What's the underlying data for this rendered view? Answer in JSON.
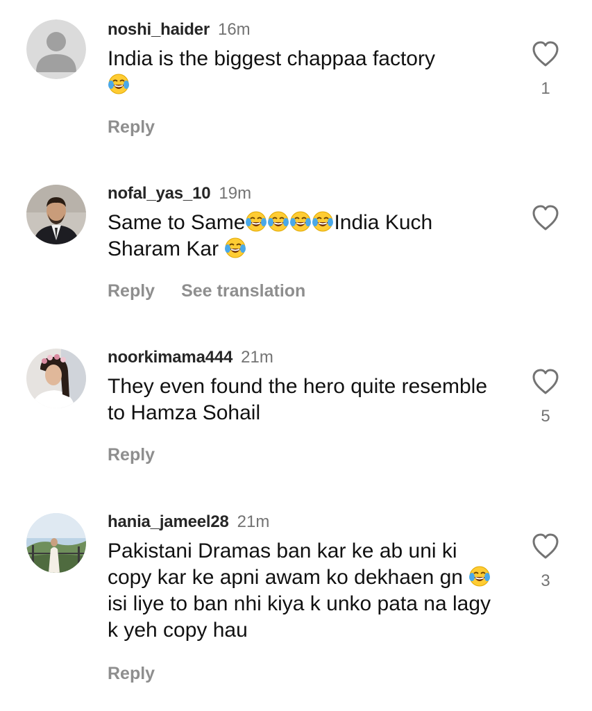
{
  "comments": [
    {
      "username": "noshi_haider",
      "time": "16m",
      "text_parts": [
        "India is the biggest chappaa factory",
        ""
      ],
      "likes": "1",
      "reply_label": "Reply",
      "avatar": "default-avatar"
    },
    {
      "username": "nofal_yas_10",
      "time": "19m",
      "text_parts": [
        "Same to Same",
        "India Kuch Sharam Kar "
      ],
      "likes": "",
      "reply_label": "Reply",
      "translation_label": "See translation",
      "avatar": "man-in-suit-avatar"
    },
    {
      "username": "noorkimama444",
      "time": "21m",
      "text_parts": [
        "They even found the hero quite resemble to Hamza Sohail"
      ],
      "likes": "5",
      "reply_label": "Reply",
      "avatar": "woman-flower-crown-avatar"
    },
    {
      "username": "hania_jameel28",
      "time": "21m",
      "text_parts": [
        "Pakistani Dramas ban kar ke ab uni ki copy kar ke apni awam ko dekhaen gn ",
        " isi liye to ban nhi kiya k unko pata na lagy k yeh copy hau"
      ],
      "likes": "3",
      "reply_label": "Reply",
      "avatar": "outdoor-landscape-avatar"
    }
  ],
  "icons": {
    "like": "heart-outline-icon",
    "emoji": "face-with-tears-of-joy"
  },
  "colors": {
    "username": "#262626",
    "secondary": "#737373",
    "action": "#8e8e8e",
    "emoji_face": "#FFCC33",
    "emoji_tears": "#4AA8E8"
  }
}
